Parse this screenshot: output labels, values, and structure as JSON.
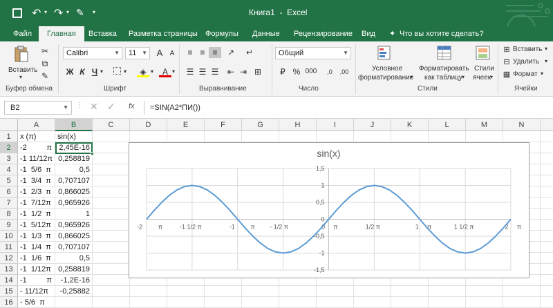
{
  "titlebar": {
    "title": "Книга1  -  Excel"
  },
  "tabs": [
    "Файл",
    "Главная",
    "Вставка",
    "Разметка страницы",
    "Формулы",
    "Данные",
    "Рецензирование",
    "Вид"
  ],
  "tell_me": "Что вы хотите сделать?",
  "ribbon": {
    "paste_label": "Вставить",
    "clipboard_label": "Буфер обмена",
    "font_name": "Calibri",
    "font_size": "11",
    "bold": "Ж",
    "italic": "К",
    "underline": "Ч",
    "grow_font": "A",
    "shrink_font": "A",
    "font_group_label": "Шрифт",
    "align_group_label": "Выравнивание",
    "number_format": "Общий",
    "number_group_label": "Число",
    "cond_format_line1": "Условное",
    "cond_format_line2": "форматирование",
    "format_table_line1": "Форматировать",
    "format_table_line2": "как таблицу",
    "cell_styles_line1": "Стили",
    "cell_styles_line2": "ячеек",
    "styles_group_label": "Стили",
    "insert_label": "Вставить",
    "delete_label": "Удалить",
    "format_label": "Формат",
    "cells_group_label": "Ячейки",
    "percent": "%",
    "thousands": "000",
    "dec_inc": ",0",
    "dec_dec": ",00"
  },
  "formula_bar": {
    "name_box": "B2",
    "fx": "fx",
    "formula": "=SIN(A2*ПИ())"
  },
  "columns": [
    "A",
    "B",
    "C",
    "D",
    "E",
    "F",
    "G",
    "H",
    "I",
    "J",
    "K",
    "L",
    "M",
    "N",
    "O"
  ],
  "rows": [
    {
      "num": "1",
      "a": "x (π)",
      "b": "sin(x)"
    },
    {
      "num": "2",
      "a": "-2",
      "a2": "π",
      "b": "2,45E-16"
    },
    {
      "num": "3",
      "a": "-1 11/12π",
      "a2": "",
      "b": "0,258819"
    },
    {
      "num": "4",
      "a": "-1  5/6  π",
      "a2": "",
      "b": "0,5"
    },
    {
      "num": "5",
      "a": "-1  3/4  π",
      "a2": "",
      "b": "0,707107"
    },
    {
      "num": "6",
      "a": "-1  2/3  π",
      "a2": "",
      "b": "0,866025"
    },
    {
      "num": "7",
      "a": "-1  7/12π",
      "a2": "",
      "b": "0,965926"
    },
    {
      "num": "8",
      "a": "-1  1/2  π",
      "a2": "",
      "b": "1"
    },
    {
      "num": "9",
      "a": "-1  5/12π",
      "a2": "",
      "b": "0,965926"
    },
    {
      "num": "10",
      "a": "-1  1/3  π",
      "a2": "",
      "b": "0,866025"
    },
    {
      "num": "11",
      "a": "-1  1/4  π",
      "a2": "",
      "b": "0,707107"
    },
    {
      "num": "12",
      "a": "-1  1/6  π",
      "a2": "",
      "b": "0,5"
    },
    {
      "num": "13",
      "a": "-1  1/12π",
      "a2": "",
      "b": "0,258819"
    },
    {
      "num": "14",
      "a": "-1",
      "a2": "π",
      "b": "-1,2E-16"
    },
    {
      "num": "15",
      "a": "- 11/12π",
      "a2": "",
      "b": "-0,25882"
    },
    {
      "num": "16",
      "a": "- 5/6  π",
      "a2": "",
      "b": ""
    }
  ],
  "chart_data": {
    "type": "line",
    "title": "sin(x)",
    "xlabel": "",
    "ylabel": "",
    "xlim": [
      -2,
      2
    ],
    "ylim": [
      -1.5,
      1.5
    ],
    "y_ticks": [
      "1,5",
      "1",
      "0,5",
      "0",
      "-0,5",
      "-1",
      "-1,5"
    ],
    "y_tick_values": [
      1.5,
      1,
      0.5,
      0,
      -0.5,
      -1,
      -1.5
    ],
    "x_ticks": [
      "-2",
      "π",
      "-1 1/2 π",
      "-1",
      "π",
      "- 1/2 π",
      "0",
      "π",
      "1/2 π",
      "1",
      "π",
      "1 1/2 π",
      "2",
      "π"
    ],
    "x_tick_values": [
      -2,
      -1.5,
      -1,
      -0.5,
      0,
      0.5,
      1,
      1.5,
      2
    ],
    "series": [
      {
        "name": "",
        "x": [
          -2,
          -1.917,
          -1.833,
          -1.75,
          -1.667,
          -1.583,
          -1.5,
          -1.417,
          -1.333,
          -1.25,
          -1.167,
          -1.083,
          -1,
          -0.917,
          -0.833,
          -0.75,
          -0.667,
          -0.583,
          -0.5,
          -0.417,
          -0.333,
          -0.25,
          -0.167,
          -0.083,
          0,
          0.083,
          0.167,
          0.25,
          0.333,
          0.417,
          0.5,
          0.583,
          0.667,
          0.75,
          0.833,
          0.917,
          1,
          1.083,
          1.167,
          1.25,
          1.333,
          1.417,
          1.5,
          1.583,
          1.667,
          1.75,
          1.833,
          1.917,
          2
        ],
        "values": [
          0,
          0.2588,
          0.5,
          0.7071,
          0.866,
          0.9659,
          1,
          0.9659,
          0.866,
          0.7071,
          0.5,
          0.2588,
          0,
          -0.2588,
          -0.5,
          -0.7071,
          -0.866,
          -0.9659,
          -1,
          -0.9659,
          -0.866,
          -0.7071,
          -0.5,
          -0.2588,
          0,
          0.2588,
          0.5,
          0.7071,
          0.866,
          0.9659,
          1,
          0.9659,
          0.866,
          0.7071,
          0.5,
          0.2588,
          0,
          -0.2588,
          -0.5,
          -0.7071,
          -0.866,
          -0.9659,
          -1,
          -0.9659,
          -0.866,
          -0.7071,
          -0.5,
          -0.2588,
          0
        ]
      }
    ],
    "grid": true,
    "line_color": "#5b9bd5"
  }
}
